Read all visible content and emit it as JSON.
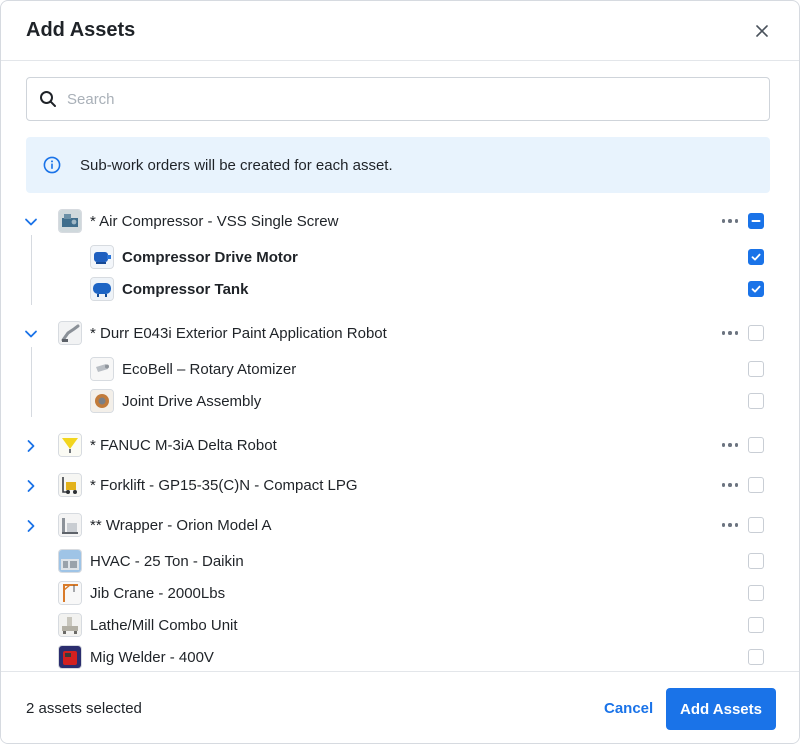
{
  "modal": {
    "title": "Add Assets",
    "close_icon": "close-icon"
  },
  "search": {
    "placeholder": "Search",
    "value": ""
  },
  "info": {
    "text": "Sub-work orders will be created for each asset."
  },
  "assets": [
    {
      "label": "* Air Compressor - VSS Single Screw",
      "expanded": true,
      "state": "partial",
      "has_more": true,
      "children": [
        {
          "label": "Compressor Drive Motor",
          "state": "checked"
        },
        {
          "label": "Compressor Tank",
          "state": "checked"
        }
      ]
    },
    {
      "label": "* Durr E043i Exterior Paint Application Robot",
      "expanded": true,
      "state": "unchecked",
      "has_more": true,
      "children": [
        {
          "label": "EcoBell – Rotary Atomizer",
          "state": "unchecked"
        },
        {
          "label": "Joint Drive Assembly",
          "state": "unchecked"
        }
      ]
    },
    {
      "label": "* FANUC M-3iA Delta Robot",
      "expanded": false,
      "state": "unchecked",
      "has_more": true
    },
    {
      "label": "* Forklift - GP15-35(C)N - Compact LPG",
      "expanded": false,
      "state": "unchecked",
      "has_more": true
    },
    {
      "label": "** Wrapper - Orion Model A",
      "expanded": false,
      "state": "unchecked",
      "has_more": true
    },
    {
      "label": "HVAC - 25 Ton - Daikin",
      "state": "unchecked"
    },
    {
      "label": "Jib Crane - 2000Lbs",
      "state": "unchecked"
    },
    {
      "label": "Lathe/Mill Combo Unit",
      "state": "unchecked"
    },
    {
      "label": "Mig Welder - 400V",
      "state": "unchecked"
    }
  ],
  "footer": {
    "selected_count": "2 assets selected",
    "cancel_label": "Cancel",
    "add_label": "Add Assets"
  },
  "colors": {
    "accent": "#1a73e8",
    "info_bg": "#e8f3fd"
  }
}
